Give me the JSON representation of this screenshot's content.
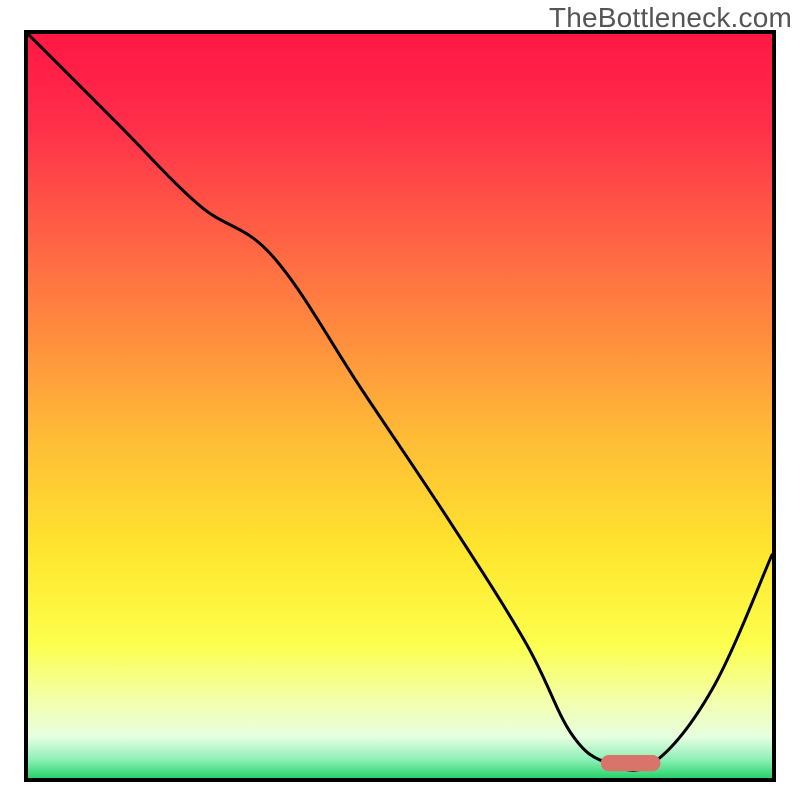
{
  "watermark": "TheBottleneck.com",
  "chart_data": {
    "type": "line",
    "title": "",
    "xlabel": "",
    "ylabel": "",
    "xlim": [
      0,
      100
    ],
    "ylim": [
      0,
      100
    ],
    "background_gradient": {
      "stops": [
        {
          "offset": 0.0,
          "color": "#ff1744"
        },
        {
          "offset": 0.12,
          "color": "#ff2e4a"
        },
        {
          "offset": 0.25,
          "color": "#ff5a45"
        },
        {
          "offset": 0.4,
          "color": "#ff8b3e"
        },
        {
          "offset": 0.55,
          "color": "#ffbe36"
        },
        {
          "offset": 0.7,
          "color": "#ffe72e"
        },
        {
          "offset": 0.82,
          "color": "#fcff4d"
        },
        {
          "offset": 0.9,
          "color": "#f2ffb0"
        },
        {
          "offset": 0.945,
          "color": "#e6ffe0"
        },
        {
          "offset": 0.975,
          "color": "#8ff0b8"
        },
        {
          "offset": 1.0,
          "color": "#27d36b"
        }
      ]
    },
    "series": [
      {
        "name": "bottleneck-curve",
        "color": "#000000",
        "x": [
          0,
          12,
          23,
          33,
          45,
          57,
          67,
          73,
          78,
          84,
          92,
          100
        ],
        "y": [
          100,
          88,
          77,
          70,
          52,
          34,
          18,
          6,
          2,
          2,
          12,
          30
        ]
      }
    ],
    "marker": {
      "name": "optimal-range-marker",
      "color": "#d9746b",
      "x_start": 77,
      "x_end": 85,
      "y": 2,
      "thickness": 2.2
    }
  }
}
